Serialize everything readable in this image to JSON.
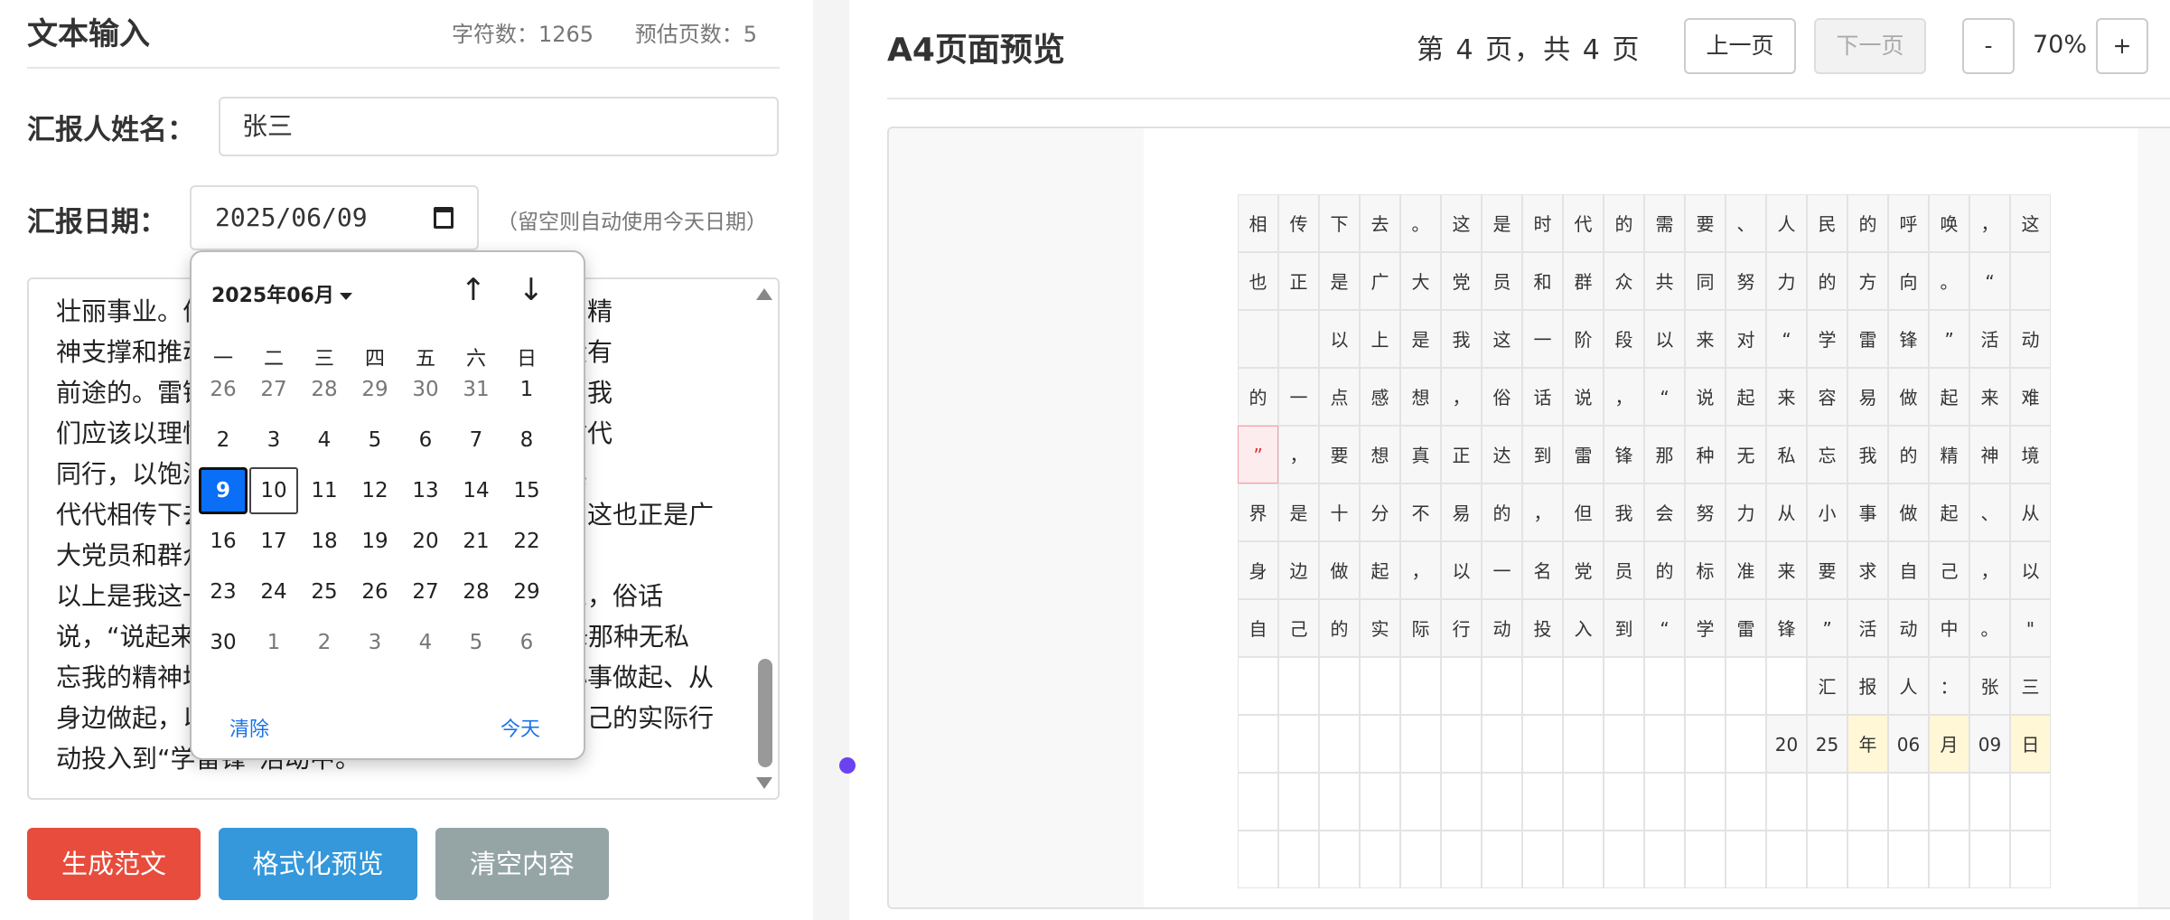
{
  "left": {
    "title": "文本输入",
    "char_count": "字符数：1265",
    "est_pages": "预估页数：5",
    "name_label": "汇报人姓名：",
    "name_value": "张三",
    "date_label": "汇报日期：",
    "date_value": "2025/06/09",
    "date_hint": "（留空则自动使用今天日期）",
    "text_lines": [
      "壮丽事业。伟大的事业需要伟大的精神，崇高的精",
      "神支撑和推动，一个没有精神力量的民族，是没有",
      "前途的。雷锋精神是我们中华民族的精神财富，我",
      "们应该以理性的思考来认识它，让雷锋精神与时代",
      "同行，以饱满的热情投身于学雷锋活动，并将其",
      "代代相传下去。这是时代的需要、人民的呼唤，这也正是广",
      "大党员和群众共同努力的方向。",
      "以上是我这一阶段以来对学雷锋活动的一点感想，俗话",
      "说，“说起来容易做起来难”，要想真正达到雷锋那种无私",
      "忘我的精神境界是十分不易的，但我会努力从小事做起、从",
      "身边做起，以一名党员的标准来要求自己，以自己的实际行",
      "动投入到“学雷锋”活动中。"
    ],
    "buttons": {
      "generate": "生成范文",
      "format": "格式化预览",
      "clear": "清空内容"
    }
  },
  "calendar": {
    "month_label": "2025年06月",
    "up_icon": "↑",
    "down_icon": "↓",
    "weekdays": [
      "一",
      "二",
      "三",
      "四",
      "五",
      "六",
      "日"
    ],
    "days": [
      [
        "26",
        "27",
        "28",
        "29",
        "30",
        "31",
        "1"
      ],
      [
        "2",
        "3",
        "4",
        "5",
        "6",
        "7",
        "8"
      ],
      [
        "9",
        "10",
        "11",
        "12",
        "13",
        "14",
        "15"
      ],
      [
        "16",
        "17",
        "18",
        "19",
        "20",
        "21",
        "22"
      ],
      [
        "23",
        "24",
        "25",
        "26",
        "27",
        "28",
        "29"
      ],
      [
        "30",
        "1",
        "2",
        "3",
        "4",
        "5",
        "6"
      ]
    ],
    "selected_day": "9",
    "today_day": "10",
    "clear_label": "清除",
    "today_label": "今天"
  },
  "right": {
    "title": "A4页面预览",
    "pager": "第 4 页，共 4 页",
    "prev_label": "上一页",
    "next_label": "下一页",
    "zoom_out": "-",
    "zoom_value": "70%",
    "zoom_in": "+",
    "grid_rows": [
      [
        "相",
        "传",
        "下",
        "去",
        "。",
        "这",
        "是",
        "时",
        "代",
        "的",
        "需",
        "要",
        "、",
        "人",
        "民",
        "的",
        "呼",
        "唤",
        "，",
        "这"
      ],
      [
        "也",
        "正",
        "是",
        "广",
        "大",
        "党",
        "员",
        "和",
        "群",
        "众",
        "共",
        "同",
        "努",
        "力",
        "的",
        "方",
        "向",
        "。",
        "“",
        ""
      ],
      [
        "",
        "",
        "以",
        "上",
        "是",
        "我",
        "这",
        "一",
        "阶",
        "段",
        "以",
        "来",
        "对",
        "“",
        "学",
        "雷",
        "锋",
        "”",
        "活",
        "动"
      ],
      [
        "的",
        "一",
        "点",
        "感",
        "想",
        "，",
        "俗",
        "话",
        "说",
        "，",
        "“",
        "说",
        "起",
        "来",
        "容",
        "易",
        "做",
        "起",
        "来",
        "难"
      ],
      [
        "”",
        "，",
        "要",
        "想",
        "真",
        "正",
        "达",
        "到",
        "雷",
        "锋",
        "那",
        "种",
        "无",
        "私",
        "忘",
        "我",
        "的",
        "精",
        "神",
        "境"
      ],
      [
        "界",
        "是",
        "十",
        "分",
        "不",
        "易",
        "的",
        "，",
        "但",
        "我",
        "会",
        "努",
        "力",
        "从",
        "小",
        "事",
        "做",
        "起",
        "、",
        "从"
      ],
      [
        "身",
        "边",
        "做",
        "起",
        "，",
        "以",
        "一",
        "名",
        "党",
        "员",
        "的",
        "标",
        "准",
        "来",
        "要",
        "求",
        "自",
        "己",
        "，",
        "以"
      ],
      [
        "自",
        "己",
        "的",
        "实",
        "际",
        "行",
        "动",
        "投",
        "入",
        "到",
        "“",
        "学",
        "雷",
        "锋",
        "”",
        "活",
        "动",
        "中",
        "。",
        "\""
      ],
      [
        "",
        "",
        "",
        "",
        "",
        "",
        "",
        "",
        "",
        "",
        "",
        "",
        "",
        "",
        "汇",
        "报",
        "人",
        "：",
        "张",
        "三"
      ],
      [
        "",
        "",
        "",
        "",
        "",
        "",
        "",
        "",
        "",
        "",
        "",
        "",
        "",
        "20",
        "25",
        "年",
        "06",
        "月",
        "09",
        "日"
      ],
      [
        "",
        "",
        "",
        "",
        "",
        "",
        "",
        "",
        "",
        "",
        "",
        "",
        "",
        "",
        "",
        "",
        "",
        "",
        "",
        ""
      ],
      [
        "",
        "",
        "",
        "",
        "",
        "",
        "",
        "",
        "",
        "",
        "",
        "",
        "",
        "",
        "",
        "",
        "",
        "",
        "",
        ""
      ]
    ],
    "highlight_red": [
      [
        4,
        0
      ]
    ],
    "highlight_yellow": [
      [
        9,
        15
      ],
      [
        9,
        17
      ],
      [
        9,
        19
      ]
    ]
  }
}
